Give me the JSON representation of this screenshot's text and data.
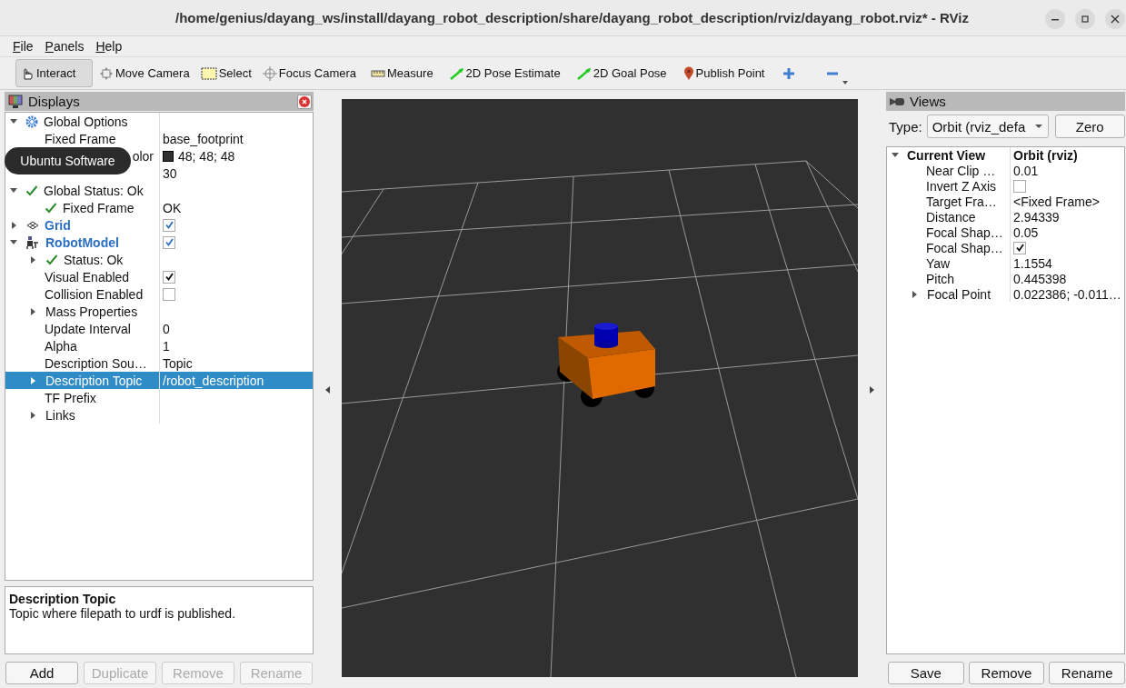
{
  "window": {
    "title": "/home/genius/dayang_ws/install/dayang_robot_description/share/dayang_robot_description/rviz/dayang_robot.rviz* - RViz"
  },
  "menu": [
    {
      "label": "File"
    },
    {
      "label": "Panels"
    },
    {
      "label": "Help"
    }
  ],
  "toolbar": [
    {
      "label": "Interact",
      "selected": true
    },
    {
      "label": "Move Camera",
      "selected": false
    },
    {
      "label": "Select",
      "selected": false
    },
    {
      "label": "Focus Camera",
      "selected": false
    },
    {
      "label": "Measure",
      "selected": false
    },
    {
      "label": "2D Pose Estimate",
      "selected": false
    },
    {
      "label": "2D Goal Pose",
      "selected": false
    },
    {
      "label": "Publish Point",
      "selected": false
    },
    {
      "selected": false
    },
    {
      "selected": false
    }
  ],
  "displays": {
    "title": "Displays",
    "tree": [
      {
        "name": "Global Options",
        "kind": "group",
        "expanded": true,
        "selected": false,
        "children": [
          {
            "name": "Fixed Frame",
            "kind": "text",
            "value": "base_footprint",
            "selected": false
          },
          {
            "name": "olor",
            "kind": "color",
            "covered": true,
            "color": "#303030",
            "value": "48; 48; 48",
            "selected": false
          },
          {
            "kind": "text",
            "value": "30",
            "selected": false
          }
        ]
      },
      {
        "name": "Global Status: Ok",
        "kind": "group",
        "expanded": true,
        "selected": false,
        "children": [
          {
            "name": "Fixed Frame",
            "kind": "text",
            "value": "OK",
            "selected": false
          }
        ]
      },
      {
        "name": "Grid",
        "kind": "display",
        "expanded": false,
        "checked": true,
        "selected": false
      },
      {
        "name": "RobotModel",
        "kind": "display",
        "expanded": true,
        "checked": true,
        "selected": false,
        "children": [
          {
            "name": "Status: Ok",
            "kind": "group",
            "expanded": false,
            "selected": false
          },
          {
            "name": "Visual Enabled",
            "kind": "checkbox",
            "checked": true,
            "selected": false
          },
          {
            "name": "Collision Enabled",
            "kind": "checkbox",
            "checked": false,
            "selected": false
          },
          {
            "name": "Mass Properties",
            "kind": "group",
            "expanded": false,
            "selected": false
          },
          {
            "name": "Update Interval",
            "kind": "text",
            "value": "0",
            "selected": false
          },
          {
            "name": "Alpha",
            "kind": "text",
            "value": "1",
            "selected": false
          },
          {
            "name": "Description Sou…",
            "kind": "text",
            "value": "Topic",
            "selected": false
          },
          {
            "name": "Description Topic",
            "kind": "text",
            "expanded": false,
            "value": "/robot_description",
            "selected": true
          },
          {
            "name": "TF Prefix",
            "kind": "group",
            "selected": false
          },
          {
            "name": "Links",
            "kind": "group",
            "expanded": false,
            "selected": false
          }
        ]
      }
    ],
    "description": {
      "title": "Description Topic",
      "text": "Topic where filepath to urdf is published."
    },
    "buttons": [
      {
        "label": "Add",
        "disabled": false
      },
      {
        "label": "Duplicate",
        "disabled": true
      },
      {
        "label": "Remove",
        "disabled": true
      },
      {
        "label": "Rename",
        "disabled": true
      }
    ]
  },
  "tooltip": {
    "text": "Ubuntu Software"
  },
  "views": {
    "title": "Views",
    "type_label": "Type:",
    "type_value": "Orbit (rviz_defa",
    "zero_button": "Zero",
    "tree": [
      {
        "name": "Current View",
        "kind": "header",
        "expanded": true,
        "value": "Orbit (rviz)",
        "selected": false,
        "children": [
          {
            "name": "Near Clip …",
            "kind": "text",
            "value": "0.01",
            "selected": false
          },
          {
            "name": "Invert Z Axis",
            "kind": "checkbox",
            "checked": false,
            "selected": false
          },
          {
            "name": "Target Fra…",
            "kind": "text",
            "value": "<Fixed Frame>",
            "selected": false
          },
          {
            "name": "Distance",
            "kind": "text",
            "value": "2.94339",
            "selected": false
          },
          {
            "name": "Focal Shap…",
            "kind": "text",
            "value": "0.05",
            "selected": false
          },
          {
            "name": "Focal Shap…",
            "kind": "checkbox",
            "checked": true,
            "selected": false
          },
          {
            "name": "Yaw",
            "kind": "text",
            "value": "1.1554",
            "selected": false
          },
          {
            "name": "Pitch",
            "kind": "text",
            "value": "0.445398",
            "selected": false
          },
          {
            "name": "Focal Point",
            "kind": "text",
            "expanded": false,
            "value": "0.022386; -0.011…",
            "selected": false
          }
        ]
      }
    ],
    "buttons": [
      {
        "label": "Save",
        "disabled": false
      },
      {
        "label": "Remove",
        "disabled": false
      },
      {
        "label": "Rename",
        "disabled": false
      }
    ]
  }
}
